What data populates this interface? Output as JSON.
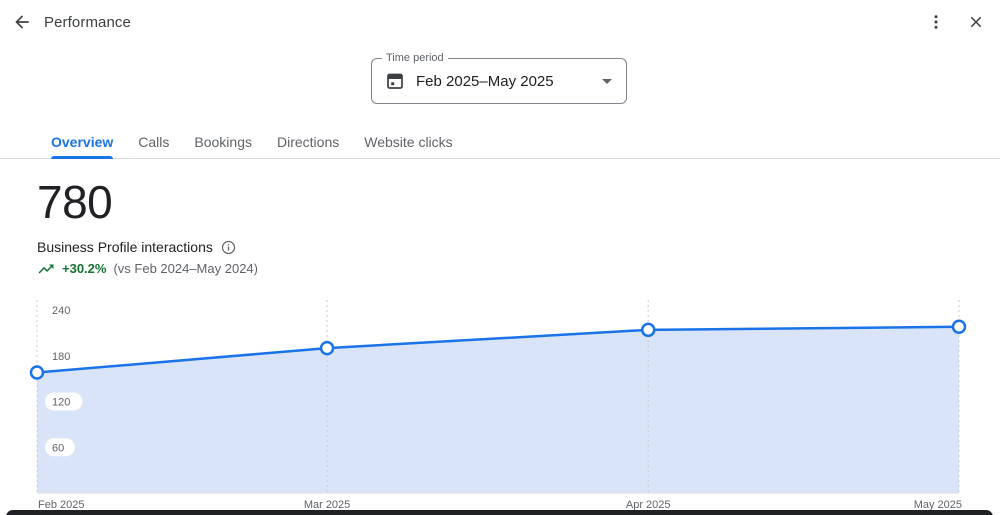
{
  "header": {
    "title": "Performance",
    "back_icon": "arrow-left",
    "more_icon": "kebab-vertical",
    "close_icon": "x"
  },
  "time_period": {
    "label": "Time period",
    "value": "Feb 2025–May 2025",
    "icon": "calendar-icon"
  },
  "tabs": {
    "active_index": 0,
    "items": [
      {
        "label": "Overview"
      },
      {
        "label": "Calls"
      },
      {
        "label": "Bookings"
      },
      {
        "label": "Directions"
      },
      {
        "label": "Website clicks"
      }
    ]
  },
  "metric": {
    "value": "780",
    "label": "Business Profile interactions",
    "info_icon": "info-circle",
    "trend_icon": "trending-up",
    "trend_pct": "+30.2%",
    "trend_compare": "(vs Feb 2024–May 2024)"
  },
  "colors": {
    "accent_blue": "#1a73e8",
    "positive_green": "#137333",
    "text_primary": "#202124",
    "text_secondary": "#5f6368",
    "divider": "#dadce0",
    "chart_fill": "#d9e4f8"
  },
  "chart_data": {
    "type": "area",
    "title": "Business Profile interactions over time",
    "x": [
      "Feb 2025",
      "Mar 2025",
      "Apr 2025",
      "May 2025"
    ],
    "x_day_offsets": [
      0,
      28,
      59,
      89
    ],
    "values": [
      158,
      190,
      214,
      218
    ],
    "total": 780,
    "ylim": [
      0,
      240
    ],
    "yticks": [
      60,
      120,
      180,
      240
    ],
    "grid": "vertical-dashed",
    "legend": "none",
    "markers": true,
    "line_color": "#1a73e8",
    "fill_color": "#d9e4f8"
  }
}
